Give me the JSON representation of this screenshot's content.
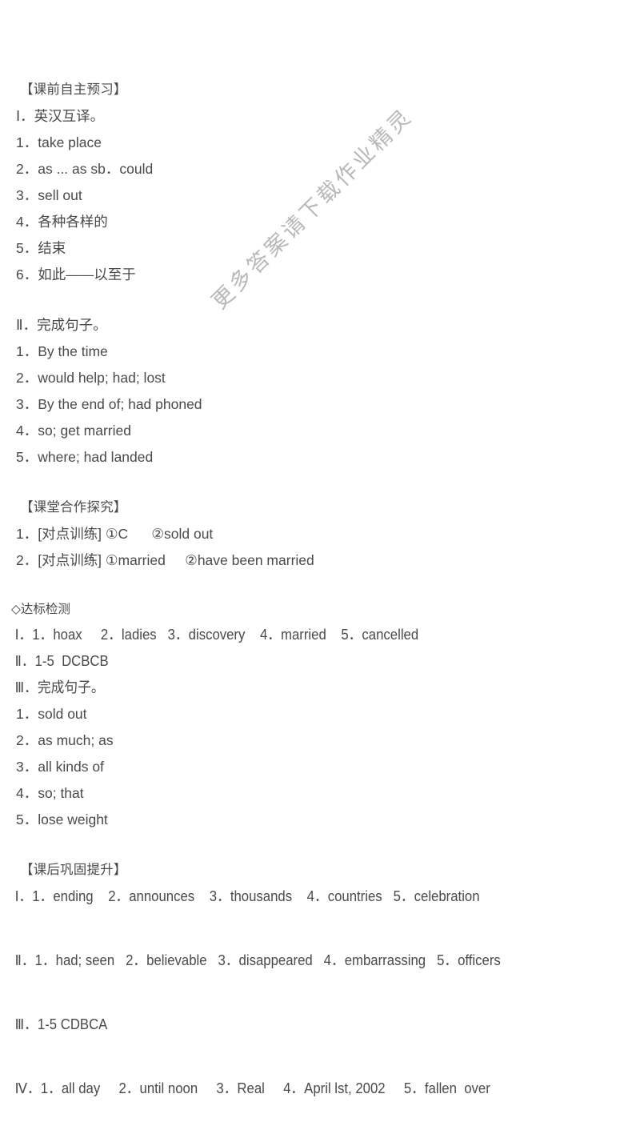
{
  "document": {
    "watermark": "更多答案请下载作业精灵",
    "text_color": "#4a4a4a",
    "watermark_color": "#b5b5b5",
    "background_color": "#ffffff"
  },
  "sections": [
    {
      "heading": "【课前自主预习】",
      "groups": [
        {
          "roman": "Ⅰ",
          "title": "Ⅰ．英汉互译。",
          "items": [
            "1．take place",
            "2．as ... as sb．could",
            "3．sell out",
            "4．各种各样的",
            "5．结束",
            "6．如此——以至于"
          ]
        },
        {
          "roman": "Ⅱ",
          "title": "Ⅱ．完成句子。",
          "items": [
            "1．By the time",
            "2．would help; had; lost",
            "3．By the end of; had phoned",
            "4．so; get married",
            "5．where; had landed"
          ]
        }
      ]
    },
    {
      "heading": "【课堂合作探究】",
      "items": [
        "1．[对点训练] ①C      ②sold out",
        "2．[对点训练] ①married     ②have been married"
      ]
    },
    {
      "heading": "◇达标检测",
      "lines": [
        "Ⅰ．1．hoax     2．ladies   3．discovery    4．married    5．cancelled",
        "Ⅱ．1-5  DCBCB",
        "Ⅲ．完成句子。"
      ],
      "items": [
        "1．sold out",
        "2．as much; as",
        "3．all kinds of",
        "4．so; that",
        "5．lose weight"
      ]
    },
    {
      "heading": "【课后巩固提升】",
      "lines": [
        "Ⅰ．1．ending    2．announces    3．thousands    4．countries   5．celebration",
        "Ⅱ．1．had; seen   2．believable   3．disappeared   4．embarrassing   5．officers",
        "Ⅲ．1-5 CDBCA",
        "Ⅳ．1．all day     2．until noon     3．Real     4．April lst, 2002     5．fallen  over"
      ]
    }
  ]
}
